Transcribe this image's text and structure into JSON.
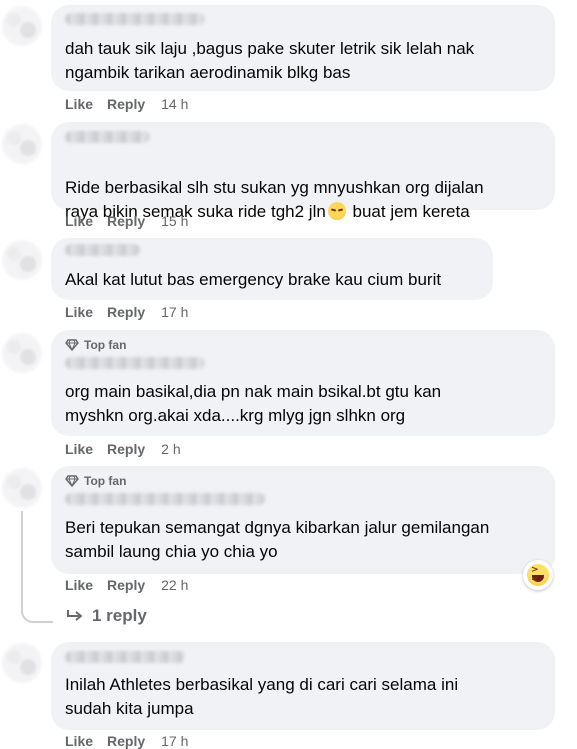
{
  "comments": [
    {
      "top_fan": "",
      "text": "dah tauk sik laju ,bagus pake skuter letrik sik lelah nak\nngambik tarikan aerodinamik blkg bas",
      "like": "Like",
      "reply": "Reply",
      "time": "14 h"
    },
    {
      "top_fan": "",
      "text_before_emoji": "Ride berbasikal slh stu sukan yg mnyushkan org dijalan\nraya bikin semak suka ride tgh2 jln",
      "emoji": "pensive-face-icon",
      "text_after_emoji": " buat jem kereta",
      "like": "Like",
      "reply": "Reply",
      "time": "15 h"
    },
    {
      "top_fan": "",
      "text": "Akal kat lutut bas emergency brake kau cium burit",
      "like": "Like",
      "reply": "Reply",
      "time": "17 h"
    },
    {
      "top_fan": "Top fan",
      "text": "org main basikal,dia pn nak main bsikal.bt gtu kan\nmyshkn org.akai xda....krg mlyg jgn slhkn org",
      "like": "Like",
      "reply": "Reply",
      "time": "2 h"
    },
    {
      "top_fan": "Top fan",
      "text": "Beri tepukan semangat dgnya kibarkan jalur gemilangan\nsambil laung chia yo chia yo",
      "like": "Like",
      "reply": "Reply",
      "time": "22 h",
      "reaction": "haha-icon",
      "replies_label": "1 reply"
    },
    {
      "top_fan": "",
      "text": "Inilah Athletes berbasikal yang di cari cari selama ini\nsudah kita jumpa",
      "like": "Like",
      "reply": "Reply",
      "time": "17 h"
    }
  ],
  "colors": {
    "bubble_bg": "#f0f2f5",
    "meta_text": "#65676b",
    "body_text": "#050505"
  }
}
